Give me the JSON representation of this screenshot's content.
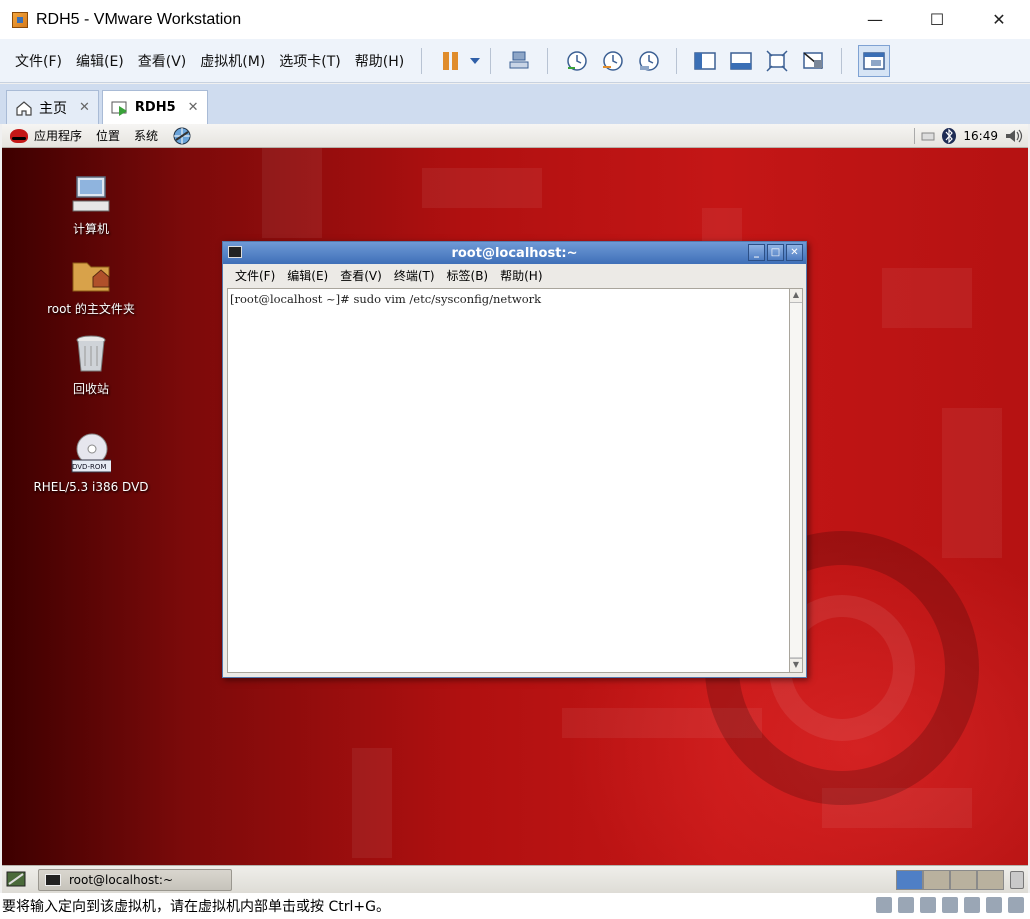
{
  "window": {
    "title": "RDH5 - VMware Workstation",
    "minimize": "—",
    "maximize": "☐",
    "close": "✕"
  },
  "menu": [
    "文件(F)",
    "编辑(E)",
    "查看(V)",
    "虚拟机(M)",
    "选项卡(T)",
    "帮助(H)"
  ],
  "tabs": [
    {
      "label": "主页",
      "close": "✕"
    },
    {
      "label": "RDH5",
      "close": "✕"
    }
  ],
  "guest_panel": {
    "applications": "应用程序",
    "places": "位置",
    "system": "系统",
    "clock": "16:49"
  },
  "desktop_icons": [
    {
      "label": "计算机"
    },
    {
      "label": "root 的主文件夹"
    },
    {
      "label": "回收站"
    },
    {
      "label": "RHEL/5.3 i386 DVD",
      "badge": "DVD-ROM"
    }
  ],
  "terminal": {
    "title": "root@localhost:~",
    "menu": [
      "文件(F)",
      "编辑(E)",
      "查看(V)",
      "终端(T)",
      "标签(B)",
      "帮助(H)"
    ],
    "content": "[root@localhost ~]# sudo vim /etc/sysconfig/network"
  },
  "taskbar": {
    "task_label": "root@localhost:~"
  },
  "status_bar": {
    "message": "要将输入定向到该虚拟机，请在虚拟机内部单击或按 Ctrl+G。"
  },
  "colors": {
    "desktop_red": "#c41616",
    "titlebar_blue": "#3f6fb8",
    "accent_orange": "#e08c2b"
  }
}
